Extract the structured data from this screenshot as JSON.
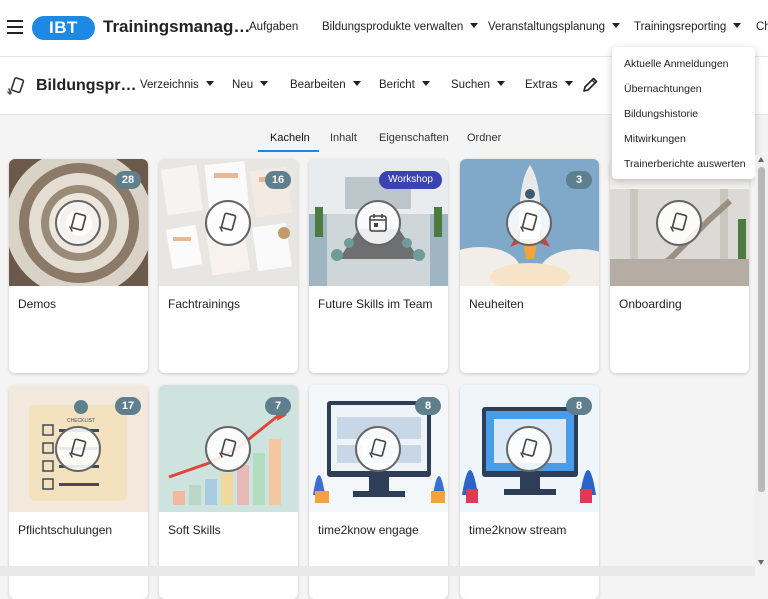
{
  "header": {
    "logo_text": "IBT",
    "app_title": "Trainingsmanag…",
    "nav": [
      {
        "label": "Aufgaben",
        "dropdown": false
      },
      {
        "label": "Bildungsprodukte verwalten",
        "dropdown": true
      },
      {
        "label": "Veranstaltungsplanung",
        "dropdown": true
      },
      {
        "label": "Trainingsreporting",
        "dropdown": true
      },
      {
        "label": "Ch",
        "dropdown": false
      }
    ],
    "accent_color": "#1e88e5"
  },
  "toolbar": {
    "module_title": "Bildungspr…",
    "menus": [
      {
        "label": "Verzeichnis"
      },
      {
        "label": "Neu"
      },
      {
        "label": "Bearbeiten"
      },
      {
        "label": "Bericht"
      },
      {
        "label": "Suchen"
      },
      {
        "label": "Extras"
      }
    ],
    "edit_icon": "pencil-icon"
  },
  "tabs": [
    {
      "label": "Kacheln",
      "active": true
    },
    {
      "label": "Inhalt",
      "active": false
    },
    {
      "label": "Eigenschaften",
      "active": false
    },
    {
      "label": "Ordner",
      "active": false
    }
  ],
  "tiles": [
    {
      "label": "Demos",
      "badge": "28",
      "icon": "document-icon"
    },
    {
      "label": "Fachtrainings",
      "badge": "16",
      "icon": "document-icon"
    },
    {
      "label": "Future Skills im Team",
      "tag": "Workshop",
      "icon": "calendar-icon"
    },
    {
      "label": "Neuheiten",
      "badge": "3",
      "icon": "document-icon"
    },
    {
      "label": "Onboarding",
      "icon": "document-icon"
    },
    {
      "label": "Pflichtschulungen",
      "badge": "17",
      "icon": "document-icon",
      "image_text": "CHECKLIST"
    },
    {
      "label": "Soft Skills",
      "badge": "7",
      "icon": "document-icon"
    },
    {
      "label": "time2know engage",
      "badge": "8",
      "icon": "document-icon"
    },
    {
      "label": "time2know stream",
      "badge": "8",
      "icon": "document-icon"
    }
  ],
  "dropdown_menu": {
    "parent": "Trainingsreporting",
    "items": [
      {
        "label": "Aktuelle Anmeldungen"
      },
      {
        "label": "Übernachtungen"
      },
      {
        "label": "Bildungshistorie"
      },
      {
        "label": "Mitwirkungen"
      },
      {
        "label": "Trainerberichte auswerten"
      }
    ]
  },
  "colors": {
    "badge": "#5f7f8e",
    "workshop_tag": "#3a44b0",
    "tab_underline": "#1e88e5"
  }
}
